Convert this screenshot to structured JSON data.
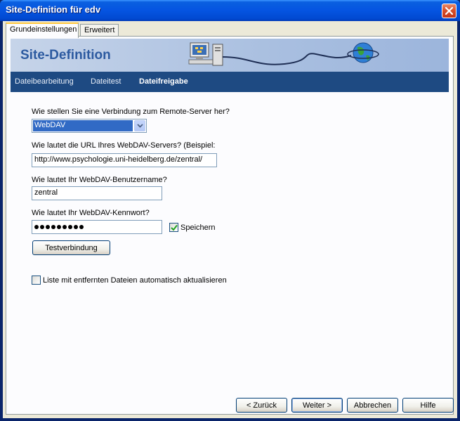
{
  "window": {
    "title": "Site-Definition für edv"
  },
  "tabs": [
    {
      "label": "Grundeinstellungen",
      "active": true
    },
    {
      "label": "Erweitert",
      "active": false
    }
  ],
  "banner": {
    "title": "Site-Definition"
  },
  "nav": {
    "items": [
      {
        "label": "Dateibearbeitung"
      },
      {
        "label": "Dateitest"
      },
      {
        "label": "Dateifreigabe",
        "selected": true
      }
    ]
  },
  "form": {
    "connection_label": "Wie stellen Sie eine Verbindung zum Remote-Server her?",
    "connection_value": "WebDAV",
    "url_label": "Wie lautet die URL Ihres WebDAV-Servers? (Beispiel:",
    "url_value": "http://www.psychologie.uni-heidelberg.de/zentral/",
    "username_label": "Wie lautet Ihr WebDAV-Benutzername?",
    "username_value": "zentral",
    "password_label": "Wie lautet Ihr WebDAV-Kennwort?",
    "password_length": 9,
    "save_label": "Speichern",
    "save_checked": true,
    "test_button": "Testverbindung",
    "auto_refresh_label": "Liste mit entfernten Dateien automatisch aktualisieren",
    "auto_refresh_checked": false
  },
  "footer": {
    "back": "< Zurück",
    "next": "Weiter >",
    "cancel": "Abbrechen",
    "help": "Hilfe"
  },
  "colors": {
    "titlebar": "#0554e1",
    "nav_bar": "#1e4a82",
    "banner_title": "#2c5aa0",
    "selection": "#316ac5"
  }
}
